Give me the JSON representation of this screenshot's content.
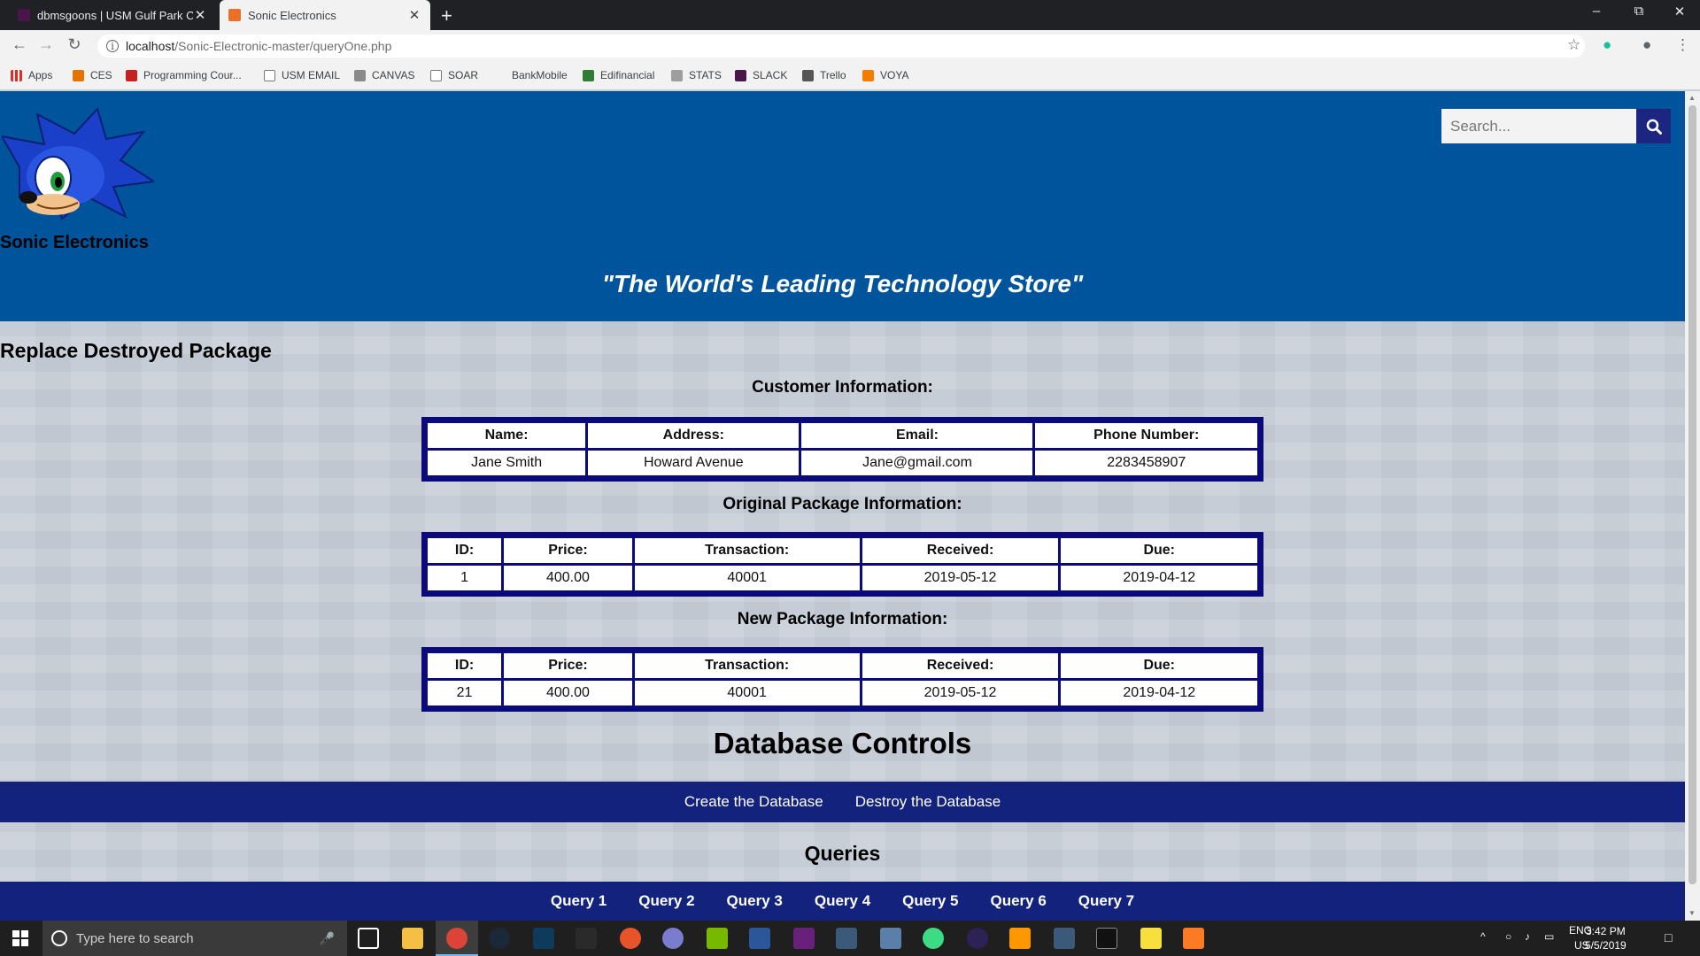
{
  "browser": {
    "tabs": [
      {
        "title": "dbmsgoons | USM Gulf Park Com",
        "favicon_color": "#4a154b",
        "active": false
      },
      {
        "title": "Sonic Electronics",
        "favicon_color": "#e8702a",
        "active": true
      }
    ],
    "url_host": "localhost",
    "url_path": "/Sonic-Electronic-master/queryOne.php",
    "bookmarks": [
      {
        "label": "Apps",
        "icon": "apps-grid-icon",
        "color": "#d93025"
      },
      {
        "label": "CES",
        "icon": "ces-icon",
        "color": "#e37400"
      },
      {
        "label": "Programming Cour...",
        "icon": "programming-icon",
        "color": "#c5221f"
      },
      {
        "label": "USM EMAIL",
        "icon": "page-icon",
        "color": "#ffffff"
      },
      {
        "label": "CANVAS",
        "icon": "canvas-icon",
        "color": "#8a8a8a"
      },
      {
        "label": "SOAR",
        "icon": "page-icon",
        "color": "#ffffff"
      },
      {
        "label": "BankMobile",
        "icon": "none",
        "color": "#f2f2f2"
      },
      {
        "label": "Edifinancial",
        "icon": "edifinancial-icon",
        "color": "#2e7d32"
      },
      {
        "label": "STATS",
        "icon": "stats-icon",
        "color": "#9e9e9e"
      },
      {
        "label": "SLACK",
        "icon": "slack-icon",
        "color": "#4a154b"
      },
      {
        "label": "Trello",
        "icon": "trello-icon",
        "color": "#555555"
      },
      {
        "label": "VOYA",
        "icon": "voya-icon",
        "color": "#f57c00"
      }
    ]
  },
  "header": {
    "site_name": "Sonic Electronics",
    "tagline": "\"The World's Leading Technology Store\"",
    "search_placeholder": "Search...",
    "bg_color": "#00549c"
  },
  "page_title": "Replace Destroyed Package",
  "customer": {
    "heading": "Customer Information:",
    "columns": [
      "Name:",
      "Address:",
      "Email:",
      "Phone Number:"
    ],
    "row": [
      "Jane Smith",
      "Howard Avenue",
      "Jane@gmail.com",
      "2283458907"
    ]
  },
  "original_package": {
    "heading": "Original Package Information:",
    "columns": [
      "ID:",
      "Price:",
      "Transaction:",
      "Received:",
      "Due:"
    ],
    "row": [
      "1",
      "400.00",
      "40001",
      "2019-05-12",
      "2019-04-12"
    ]
  },
  "new_package": {
    "heading": "New Package Information:",
    "columns": [
      "ID:",
      "Price:",
      "Transaction:",
      "Received:",
      "Due:"
    ],
    "row": [
      "21",
      "400.00",
      "40001",
      "2019-05-12",
      "2019-04-12"
    ]
  },
  "db_controls": {
    "title": "Database Controls",
    "create": "Create the Database",
    "destroy": "Destroy the Database"
  },
  "queries": {
    "title": "Queries",
    "items": [
      "Query 1",
      "Query 2",
      "Query 3",
      "Query 4",
      "Query 5",
      "Query 6",
      "Query 7"
    ]
  },
  "taskbar": {
    "search_placeholder": "Type here to search",
    "lang": "ENG",
    "region": "US",
    "time": "3:42 PM",
    "date": "5/5/2019"
  }
}
